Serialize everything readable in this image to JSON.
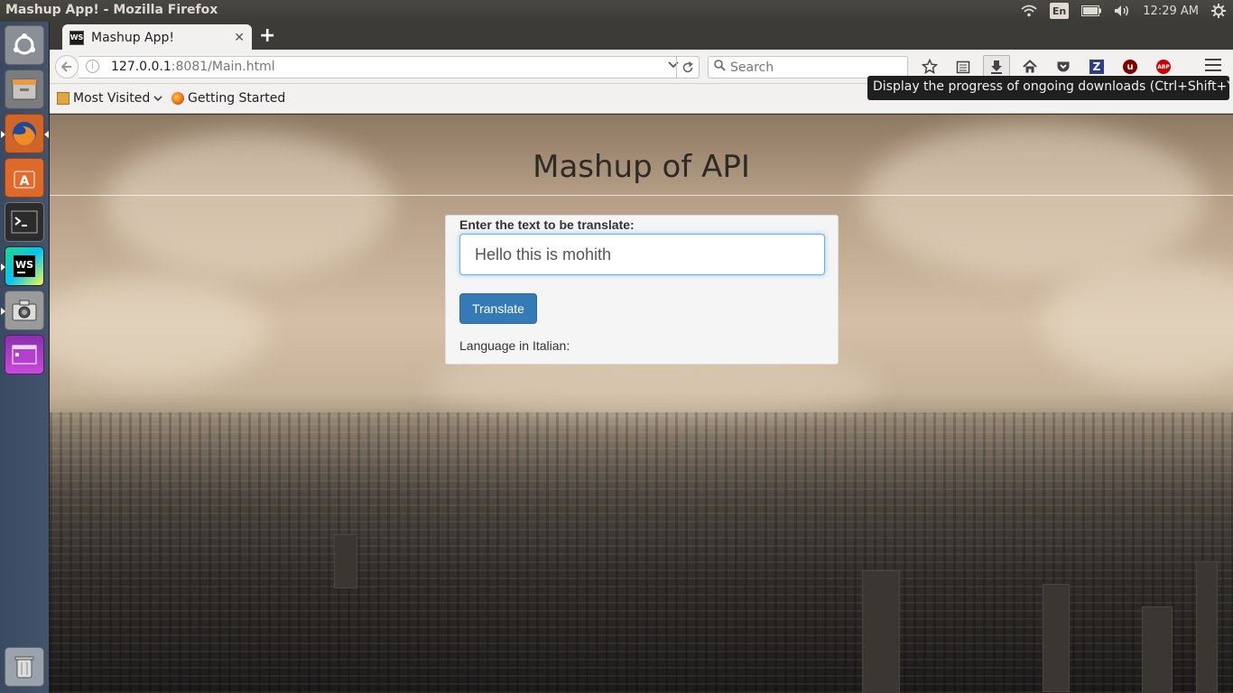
{
  "window": {
    "title": "Mashup App! - Mozilla Firefox"
  },
  "panel_indicators": {
    "lang": "En",
    "clock": "12:29 AM"
  },
  "browser": {
    "tab": {
      "title": "Mashup App!",
      "favicon": "WS"
    },
    "url_host": "127.0.0.1",
    "url_rest": ":8081/Main.html",
    "search_placeholder": "Search",
    "bookmarks": [
      {
        "label": "Most Visited"
      },
      {
        "label": "Getting Started"
      }
    ],
    "tooltip": "Display the progress of ongoing downloads (Ctrl+Shift+Y)"
  },
  "page": {
    "heading": "Mashup of API",
    "form": {
      "label": "Enter the text to be translate:",
      "input_value": "Hello this is mohith",
      "button_label": "Translate",
      "result_label": "Language in Italian:"
    }
  },
  "launcher": [
    {
      "name": "ubuntu-dash"
    },
    {
      "name": "files"
    },
    {
      "name": "firefox"
    },
    {
      "name": "software-center"
    },
    {
      "name": "terminal"
    },
    {
      "name": "webstorm"
    },
    {
      "name": "screenshot"
    },
    {
      "name": "app"
    },
    {
      "name": "trash"
    }
  ]
}
